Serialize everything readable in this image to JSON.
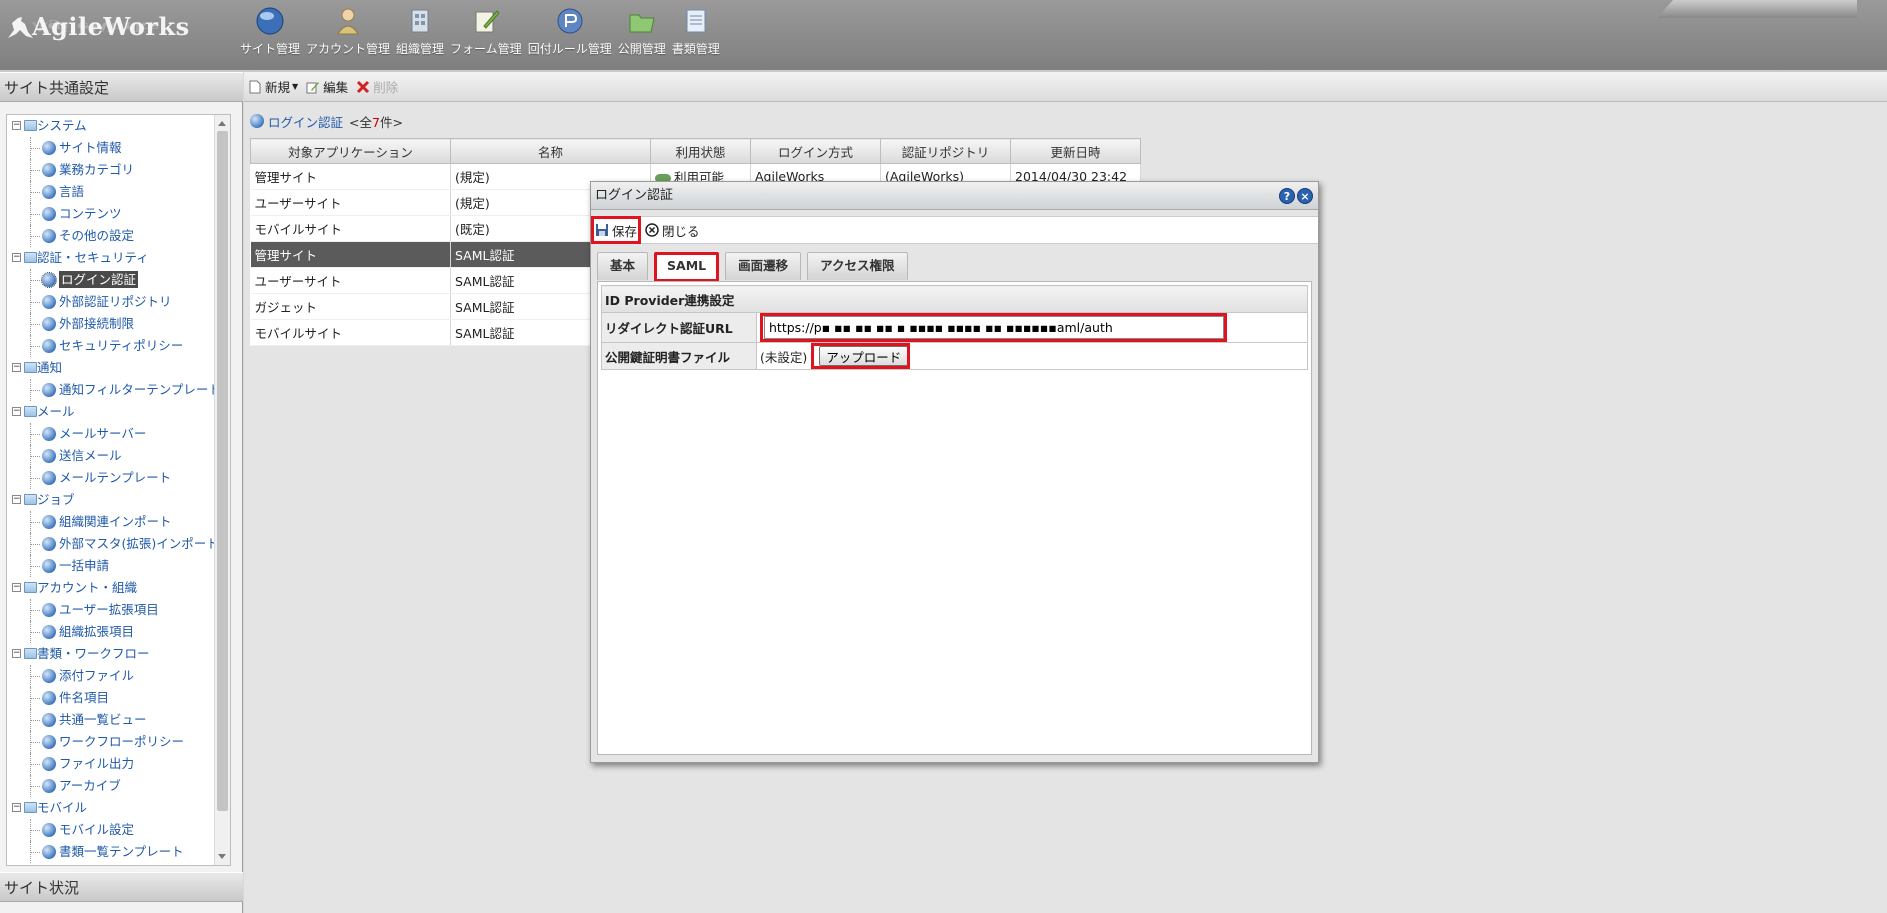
{
  "header": {
    "logo_text": "AgileWorks",
    "nav": [
      {
        "label": "サイト管理",
        "icon": "globe-icon"
      },
      {
        "label": "アカウント管理",
        "icon": "user-icon"
      },
      {
        "label": "組織管理",
        "icon": "organization-icon"
      },
      {
        "label": "フォーム管理",
        "icon": "form-edit-icon"
      },
      {
        "label": "回付ルール管理",
        "icon": "routing-icon"
      },
      {
        "label": "公開管理",
        "icon": "publish-folder-icon"
      },
      {
        "label": "書類管理",
        "icon": "document-icon"
      }
    ],
    "brand_right": "Unspecified"
  },
  "left": {
    "title": "サイト共通設定",
    "bottom_title": "サイト状況",
    "tree": [
      {
        "type": "folder",
        "label": "システム",
        "pm": "−"
      },
      {
        "type": "leaf",
        "label": "サイト情報"
      },
      {
        "type": "leaf",
        "label": "業務カテゴリ"
      },
      {
        "type": "leaf",
        "label": "言語"
      },
      {
        "type": "leaf",
        "label": "コンテンツ"
      },
      {
        "type": "leaf",
        "label": "その他の設定"
      },
      {
        "type": "folder",
        "label": "認証・セキュリティ",
        "pm": "−"
      },
      {
        "type": "leaf",
        "label": "ログイン認証",
        "selected": true
      },
      {
        "type": "leaf",
        "label": "外部認証リポジトリ"
      },
      {
        "type": "leaf",
        "label": "外部接続制限"
      },
      {
        "type": "leaf",
        "label": "セキュリティポリシー"
      },
      {
        "type": "folder",
        "label": "通知",
        "pm": "−"
      },
      {
        "type": "leaf",
        "label": "通知フィルターテンプレート"
      },
      {
        "type": "folder",
        "label": "メール",
        "pm": "−"
      },
      {
        "type": "leaf",
        "label": "メールサーバー"
      },
      {
        "type": "leaf",
        "label": "送信メール"
      },
      {
        "type": "leaf",
        "label": "メールテンプレート"
      },
      {
        "type": "folder",
        "label": "ジョブ",
        "pm": "−"
      },
      {
        "type": "leaf",
        "label": "組織関連インポート"
      },
      {
        "type": "leaf",
        "label": "外部マスタ(拡張)インポート"
      },
      {
        "type": "leaf",
        "label": "一括申請"
      },
      {
        "type": "folder",
        "label": "アカウント・組織",
        "pm": "−"
      },
      {
        "type": "leaf",
        "label": "ユーザー拡張項目"
      },
      {
        "type": "leaf",
        "label": "組織拡張項目"
      },
      {
        "type": "folder",
        "label": "書類・ワークフロー",
        "pm": "−"
      },
      {
        "type": "leaf",
        "label": "添付ファイル"
      },
      {
        "type": "leaf",
        "label": "件名項目"
      },
      {
        "type": "leaf",
        "label": "共通一覧ビュー"
      },
      {
        "type": "leaf",
        "label": "ワークフローポリシー"
      },
      {
        "type": "leaf",
        "label": "ファイル出力"
      },
      {
        "type": "leaf",
        "label": "アーカイブ"
      },
      {
        "type": "folder",
        "label": "モバイル",
        "pm": "−"
      },
      {
        "type": "leaf",
        "label": "モバイル設定"
      },
      {
        "type": "leaf",
        "label": "書類一覧テンプレート"
      }
    ]
  },
  "toolbar": {
    "new_label": "新規",
    "edit_label": "編集",
    "delete_label": "削除"
  },
  "list": {
    "title": "ログイン認証",
    "count_prefix": "<全",
    "count": "7",
    "count_suffix": "件>",
    "columns": [
      "対象アプリケーション",
      "名称",
      "利用状態",
      "ログイン方式",
      "認証リポジトリ",
      "更新日時"
    ],
    "rows": [
      [
        "管理サイト",
        "(規定)",
        "利用可能",
        "AgileWorks",
        "(AgileWorks)",
        "2014/04/30 23:42"
      ],
      [
        "ユーザーサイト",
        "(規定)",
        "",
        "",
        "",
        ""
      ],
      [
        "モバイルサイト",
        "(既定)",
        "",
        "",
        "",
        ""
      ],
      [
        "管理サイト",
        "SAML認証",
        "",
        "",
        "",
        ""
      ],
      [
        "ユーザーサイト",
        "SAML認証",
        "",
        "",
        "",
        ""
      ],
      [
        "ガジェット",
        "SAML認証",
        "",
        "",
        "",
        ""
      ],
      [
        "モバイルサイト",
        "SAML認証",
        "",
        "",
        "",
        ""
      ]
    ],
    "selected_row": 3
  },
  "dialog": {
    "title": "ログイン認証",
    "help_glyph": "?",
    "close_glyph": "×",
    "save_label": "保存",
    "close_label": "閉じる",
    "tabs": [
      "基本",
      "SAML",
      "画面遷移",
      "アクセス権限"
    ],
    "active_tab": 1,
    "section_title": "ID Provider連携設定",
    "url_label": "リダイレクト認証URL",
    "url_value": "https://p▪ ▪▪ ▪▪ ▪▪ ▪ ▪▪▪▪ ▪▪▪▪ ▪▪ ▪▪▪▪▪▪aml/auth",
    "cert_label": "公開鍵証明書ファイル",
    "cert_status": "(未設定)",
    "upload_label": "アップロード"
  }
}
